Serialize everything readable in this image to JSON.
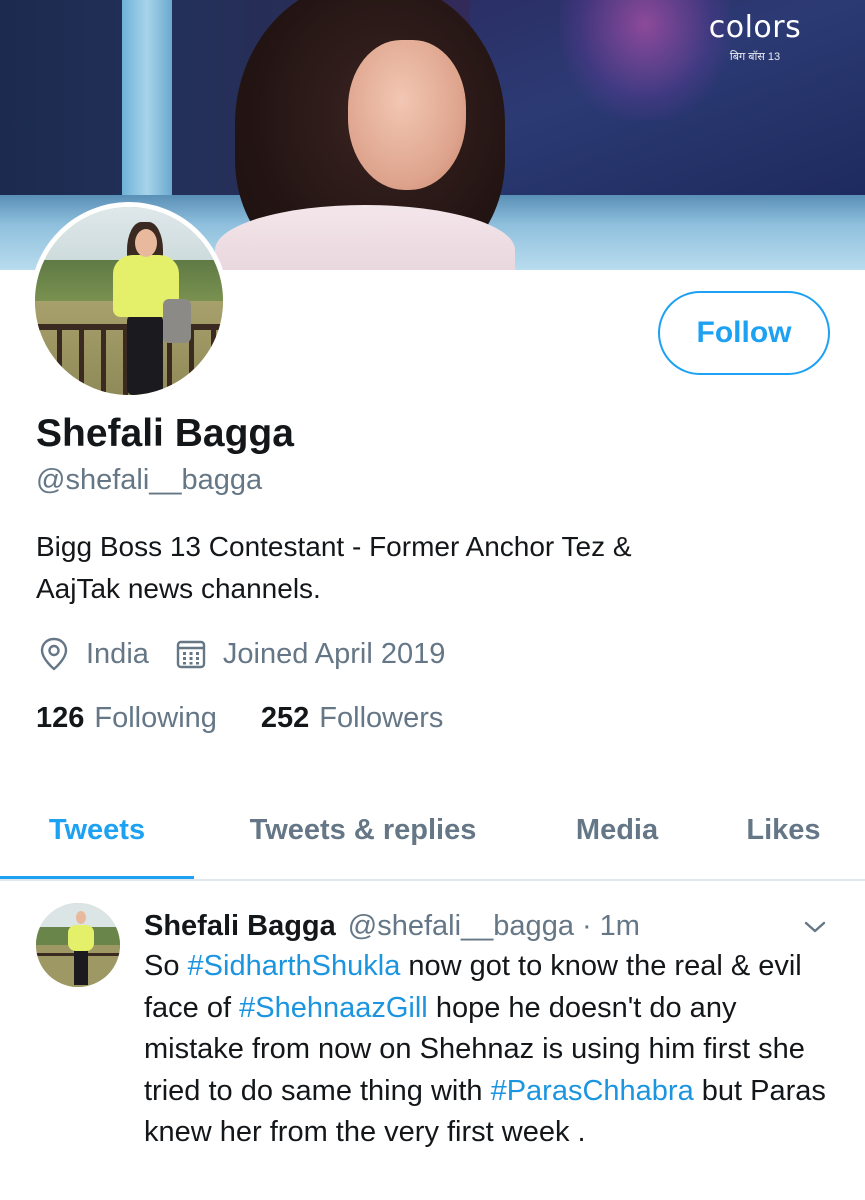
{
  "banner": {
    "logo_text": "colors",
    "logo_sub": "बिग बॉस 13"
  },
  "profile": {
    "follow_label": "Follow",
    "name": "Shefali Bagga",
    "handle": "@shefali__bagga",
    "bio_line1": "Bigg Boss 13 Contestant - Former Anchor Tez &",
    "bio_line2": "AajTak news channels.",
    "location": "India",
    "joined": "Joined April 2019",
    "following_count": "126",
    "following_label": "Following",
    "followers_count": "252",
    "followers_label": "Followers"
  },
  "tabs": [
    {
      "label": "Tweets",
      "active": true
    },
    {
      "label": "Tweets & replies",
      "active": false
    },
    {
      "label": "Media",
      "active": false
    },
    {
      "label": "Likes",
      "active": false
    }
  ],
  "tweet": {
    "name": "Shefali Bagga",
    "handle": "@shefali__bagga",
    "separator": "·",
    "time": "1m",
    "segments": [
      {
        "text": "So ",
        "type": "text"
      },
      {
        "text": "#SidharthShukla",
        "type": "hashtag"
      },
      {
        "text": " now got to know the real & evil face of ",
        "type": "text"
      },
      {
        "text": "#ShehnaazGill",
        "type": "hashtag"
      },
      {
        "text": " hope he doesn't do any mistake from now on Shehnaz is using him first she tried to do same thing with ",
        "type": "text"
      },
      {
        "text": "#ParasChhabra",
        "type": "hashtag"
      },
      {
        "text": " but Paras knew her from the very first week .",
        "type": "text"
      }
    ]
  },
  "icons": {
    "location": "location-pin-icon",
    "calendar": "calendar-icon",
    "menu": "chevron-down-icon"
  },
  "colors": {
    "accent": "#1da1f2",
    "hashtag": "#1b95e0",
    "secondary_text": "#657786",
    "primary_text": "#14171a",
    "divider": "#e1e8ed"
  }
}
